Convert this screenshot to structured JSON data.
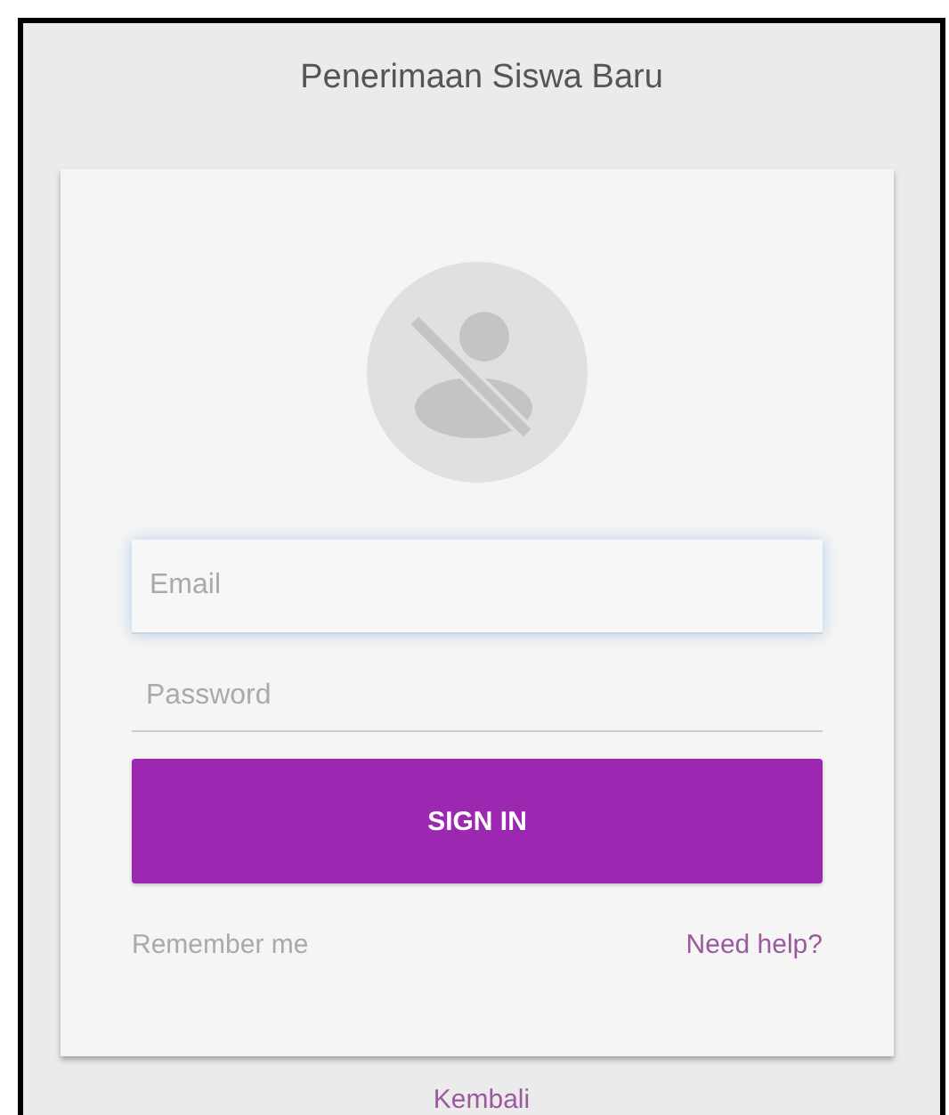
{
  "title": "Penerimaan Siswa Baru",
  "form": {
    "email": {
      "placeholder": "Email",
      "focused": true
    },
    "password": {
      "placeholder": "Password",
      "focused": false
    },
    "submit": "SIGN IN",
    "remember": "Remember me",
    "help_link": "Need help?"
  },
  "back_link": "Kembali"
}
